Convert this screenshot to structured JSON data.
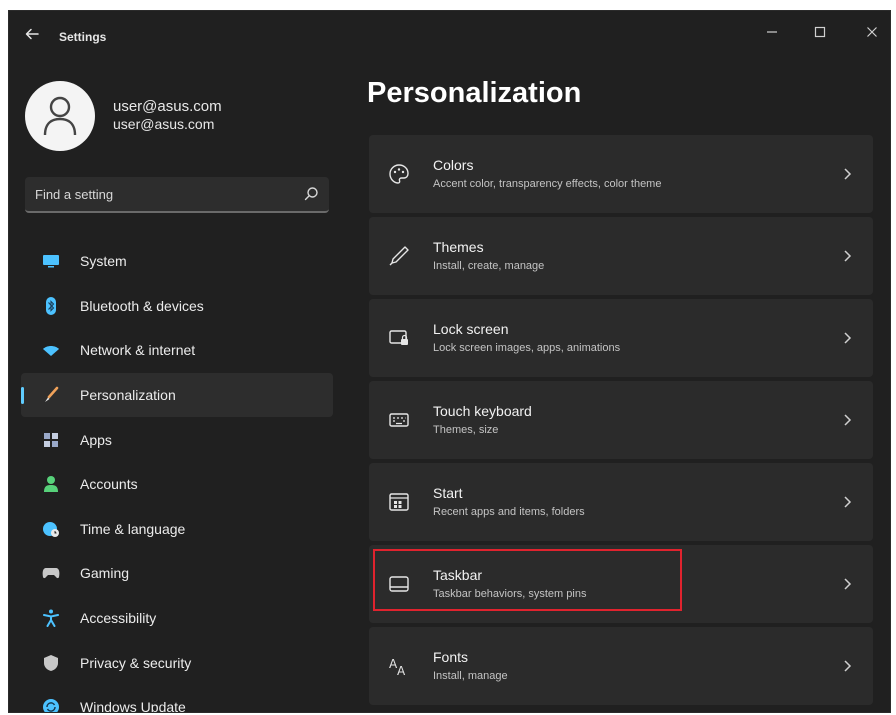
{
  "window": {
    "title": "Settings"
  },
  "profile": {
    "name": "user@asus.com",
    "email": "user@asus.com"
  },
  "search": {
    "placeholder": "Find a setting"
  },
  "nav": {
    "items": [
      {
        "label": "System",
        "icon": "monitor-icon",
        "color": "#4cc2ff"
      },
      {
        "label": "Bluetooth & devices",
        "icon": "bluetooth-icon",
        "color": "#4cc2ff"
      },
      {
        "label": "Network & internet",
        "icon": "wifi-icon",
        "color": "#4cc2ff"
      },
      {
        "label": "Personalization",
        "icon": "brush-icon",
        "color": "#f0a25a",
        "active": true
      },
      {
        "label": "Apps",
        "icon": "apps-icon",
        "color": "#9aa9c9"
      },
      {
        "label": "Accounts",
        "icon": "accounts-icon",
        "color": "#57d17a"
      },
      {
        "label": "Time & language",
        "icon": "globe-clock-icon",
        "color": "#4cc2ff"
      },
      {
        "label": "Gaming",
        "icon": "gamepad-icon",
        "color": "#c8c8c8"
      },
      {
        "label": "Accessibility",
        "icon": "accessibility-icon",
        "color": "#4cc2ff"
      },
      {
        "label": "Privacy & security",
        "icon": "shield-icon",
        "color": "#c8c8c8"
      },
      {
        "label": "Windows Update",
        "icon": "windows-update-icon",
        "color": "#4cc2ff"
      }
    ]
  },
  "main": {
    "title": "Personalization",
    "cards": [
      {
        "title": "Colors",
        "subtitle": "Accent color, transparency effects, color theme",
        "icon": "palette-icon"
      },
      {
        "title": "Themes",
        "subtitle": "Install, create, manage",
        "icon": "pen-icon"
      },
      {
        "title": "Lock screen",
        "subtitle": "Lock screen images, apps, animations",
        "icon": "lock-screen-icon"
      },
      {
        "title": "Touch keyboard",
        "subtitle": "Themes, size",
        "icon": "keyboard-icon"
      },
      {
        "title": "Start",
        "subtitle": "Recent apps and items, folders",
        "icon": "start-icon"
      },
      {
        "title": "Taskbar",
        "subtitle": "Taskbar behaviors, system pins",
        "icon": "taskbar-icon",
        "highlighted": true
      },
      {
        "title": "Fonts",
        "subtitle": "Install, manage",
        "icon": "fonts-icon"
      }
    ]
  },
  "colors": {
    "accent": "#60cdff",
    "highlight": "#e0232e"
  }
}
